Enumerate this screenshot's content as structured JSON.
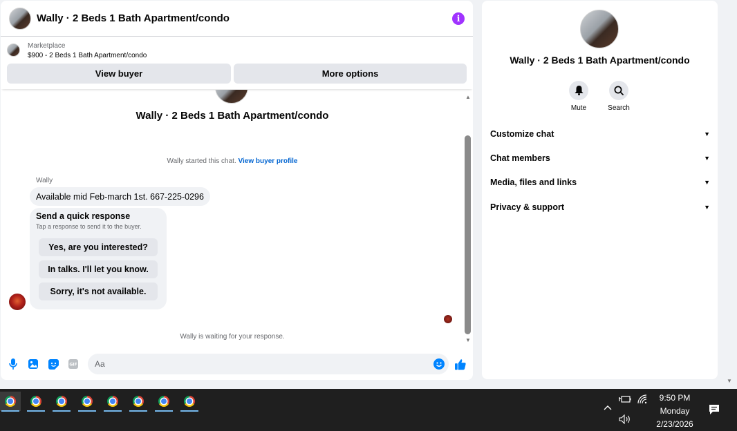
{
  "chat": {
    "title": "Wally · 2 Beds 1 Bath Apartment/condo",
    "listing_label": "Marketplace",
    "listing_price": "$900 - 2 Beds 1 Bath Apartment/condo",
    "view_buyer": "View buyer",
    "more_options": "More options",
    "conversation_title": "Wally · 2 Beds 1 Bath Apartment/condo",
    "started_text": "Wally started this chat.",
    "view_buyer_profile": "View buyer profile",
    "sender": "Wally",
    "message": "Available mid Feb-march 1st.  667-225-0296",
    "quick_title": "Send a quick response",
    "quick_sub": "Tap a response to send it to the buyer.",
    "quick_responses": [
      "Yes, are you interested?",
      "In talks. I'll let you know.",
      "Sorry, it's not available."
    ],
    "waiting_text": "Wally is waiting for your response.",
    "composer_placeholder": "Aa",
    "gif_label": "GIF"
  },
  "details": {
    "title": "Wally · 2 Beds 1 Bath Apartment/condo",
    "mute_label": "Mute",
    "search_label": "Search",
    "sections": [
      "Customize chat",
      "Chat members",
      "Media, files and links",
      "Privacy & support"
    ]
  },
  "taskbar": {
    "time": "9:50 PM",
    "day": "Monday",
    "date": "2/23/2026"
  },
  "colors": {
    "accent": "#0064d1",
    "info": "#a033ff",
    "like": "#0084ff"
  }
}
